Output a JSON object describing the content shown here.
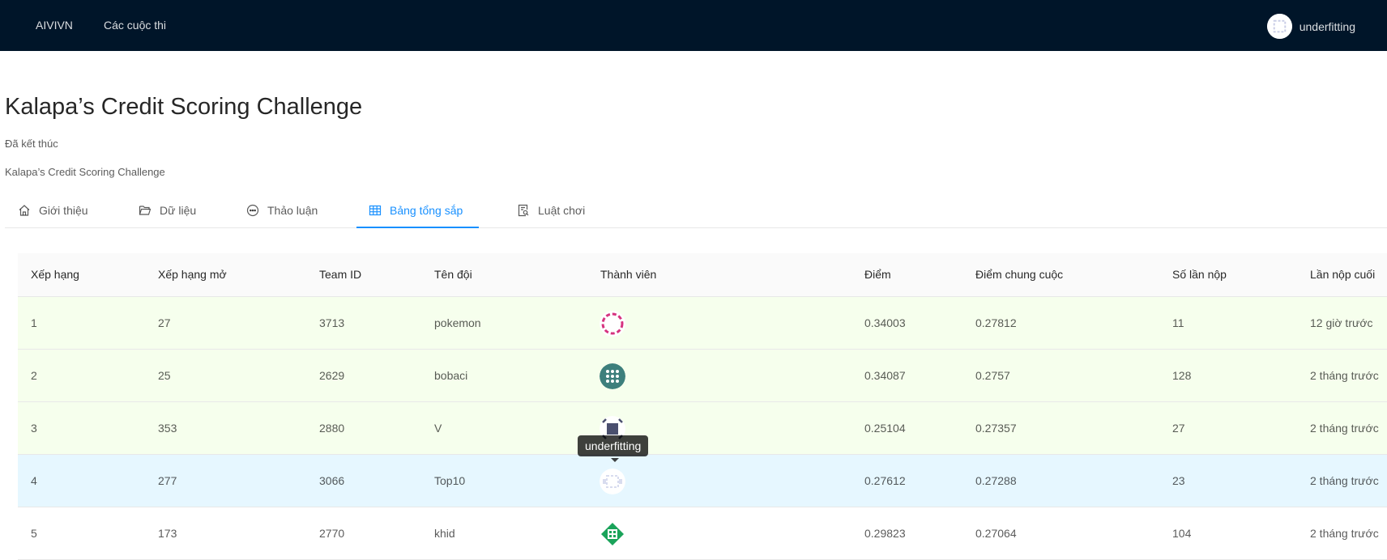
{
  "nav": {
    "home": "AIVIVN",
    "contests": "Các cuộc thi"
  },
  "user": {
    "name": "underfitting"
  },
  "page": {
    "title": "Kalapa’s Credit Scoring Challenge",
    "status": "Đã kết thúc",
    "subtitle": "Kalapa’s Credit Scoring Challenge"
  },
  "tabs": [
    {
      "label": "Giới thiệu",
      "icon": "home-icon"
    },
    {
      "label": "Dữ liệu",
      "icon": "folder-open-icon"
    },
    {
      "label": "Thảo luận",
      "icon": "message-icon"
    },
    {
      "label": "Bảng tổng sắp",
      "icon": "table-icon",
      "active": true
    },
    {
      "label": "Luật chơi",
      "icon": "file-search-icon"
    }
  ],
  "table": {
    "columns": [
      "Xếp hạng",
      "Xếp hạng mở",
      "Team ID",
      "Tên đội",
      "Thành viên",
      "Điểm",
      "Điểm chung cuộc",
      "Số lần nộp",
      "Lần nộp cuối"
    ],
    "rows": [
      {
        "rank": "1",
        "open_rank": "27",
        "team_id": "3713",
        "team": "pokemon",
        "score": "0.34003",
        "final_score": "0.27812",
        "submissions": "11",
        "last": "12 giờ trước",
        "avatar_color": "#d6337f"
      },
      {
        "rank": "2",
        "open_rank": "25",
        "team_id": "2629",
        "team": "bobaci",
        "score": "0.34087",
        "final_score": "0.2757",
        "submissions": "128",
        "last": "2 tháng trước",
        "avatar_color": "#3d7f7c"
      },
      {
        "rank": "3",
        "open_rank": "353",
        "team_id": "2880",
        "team": "V",
        "score": "0.25104",
        "final_score": "0.27357",
        "submissions": "27",
        "last": "2 tháng trước",
        "avatar_color": "#4a4f6e"
      },
      {
        "rank": "4",
        "open_rank": "277",
        "team_id": "3066",
        "team": "Top10",
        "score": "0.27612",
        "final_score": "0.27288",
        "submissions": "23",
        "last": "2 tháng trước",
        "avatar_color": "#d8dcef"
      },
      {
        "rank": "5",
        "open_rank": "173",
        "team_id": "2770",
        "team": "khid",
        "score": "0.29823",
        "final_score": "0.27064",
        "submissions": "104",
        "last": "2 tháng trước",
        "avatar_color": "#1aa35a"
      }
    ]
  },
  "tooltip": {
    "text": "underfitting"
  },
  "colors": {
    "header_bg": "#001529",
    "accent": "#1890ff",
    "top_row_bg": "#f6ffed",
    "own_row_bg": "#e6f7ff"
  }
}
